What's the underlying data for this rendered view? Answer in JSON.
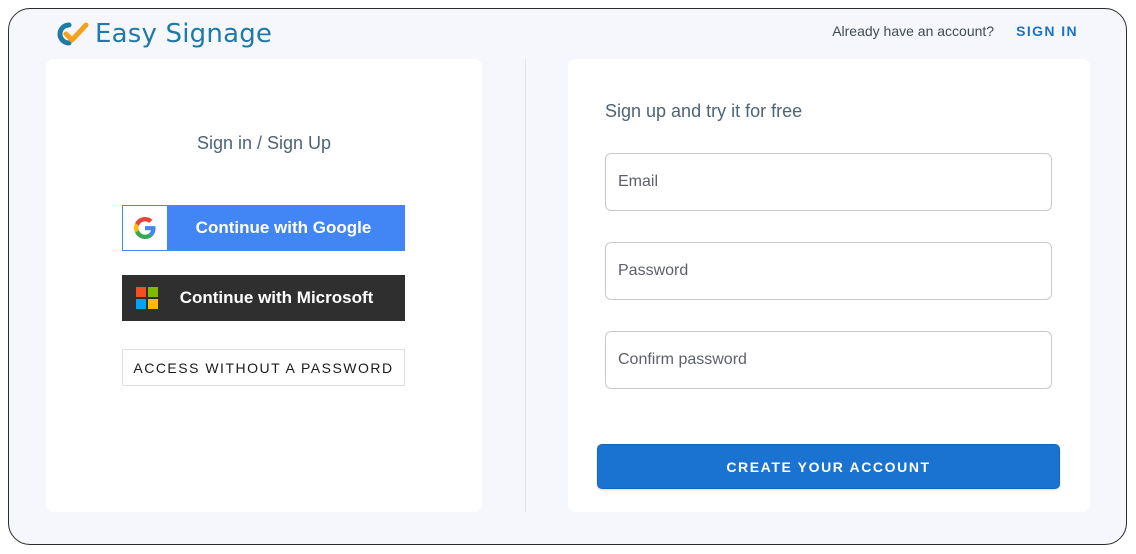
{
  "header": {
    "logo_text": "Easy Signage",
    "logo_icon": "easy-signage-logo-icon",
    "already_text": "Already have an account?",
    "signin_label": "SIGN IN"
  },
  "left_panel": {
    "heading": "Sign in / Sign Up",
    "google_label": "Continue with Google",
    "google_icon": "google-g-icon",
    "microsoft_label": "Continue with Microsoft",
    "microsoft_icon": "microsoft-logo-icon",
    "access_label": "ACCESS WITHOUT A PASSWORD"
  },
  "right_panel": {
    "heading": "Sign up and try it for free",
    "email_placeholder": "Email",
    "password_placeholder": "Password",
    "confirm_placeholder": "Confirm password",
    "create_label": "CREATE YOUR ACCOUNT"
  },
  "colors": {
    "brand": "#1f7aa6",
    "accent": "#1a73d0",
    "google_blue": "#4285f4",
    "microsoft_dark": "#2f2f2f",
    "logo_orange": "#f3a31b"
  }
}
